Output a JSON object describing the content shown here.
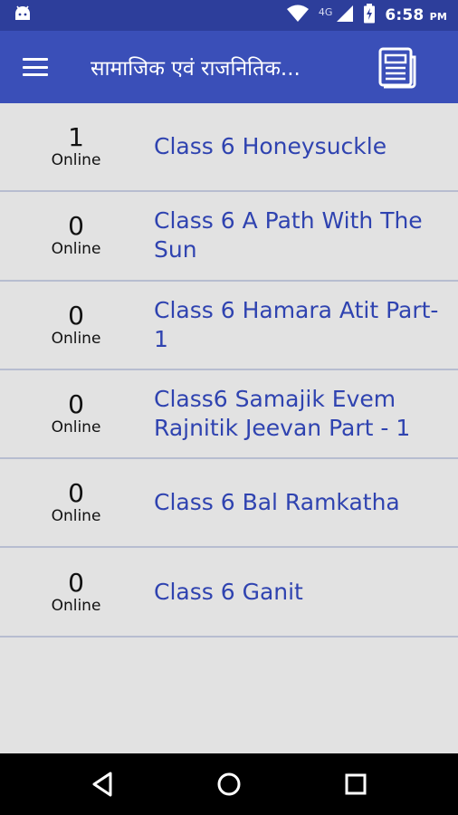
{
  "status_bar": {
    "network_label": "4G",
    "time": "6:58",
    "ampm": "PM",
    "icons": [
      "android-icon",
      "wifi-icon",
      "signal-icon",
      "battery-charging-icon"
    ]
  },
  "app_bar": {
    "title": "सामाजिक एवं राजनितिक...",
    "menu_icon": "hamburger-menu-icon",
    "action_icon": "newspaper-icon"
  },
  "classes": [
    {
      "count": "1",
      "status": "Online",
      "name": "Class 6 Honeysuckle"
    },
    {
      "count": "0",
      "status": "Online",
      "name": "Class 6 A Path With The Sun"
    },
    {
      "count": "0",
      "status": "Online",
      "name": "Class 6 Hamara Atit Part-1"
    },
    {
      "count": "0",
      "status": "Online",
      "name": "Class6 Samajik Evem Rajnitik Jeevan Part - 1"
    },
    {
      "count": "0",
      "status": "Online",
      "name": "Class 6 Bal Ramkatha"
    },
    {
      "count": "0",
      "status": "Online",
      "name": "Class 6 Ganit"
    }
  ],
  "nav_bar": {
    "icons": [
      "back-icon",
      "home-icon",
      "recents-icon"
    ]
  },
  "colors": {
    "status_bar": "#2d3e9b",
    "app_bar": "#3a4fb8",
    "link_text": "#2f43b0",
    "background": "#e2e2e2",
    "divider": "#b7bdd0"
  }
}
